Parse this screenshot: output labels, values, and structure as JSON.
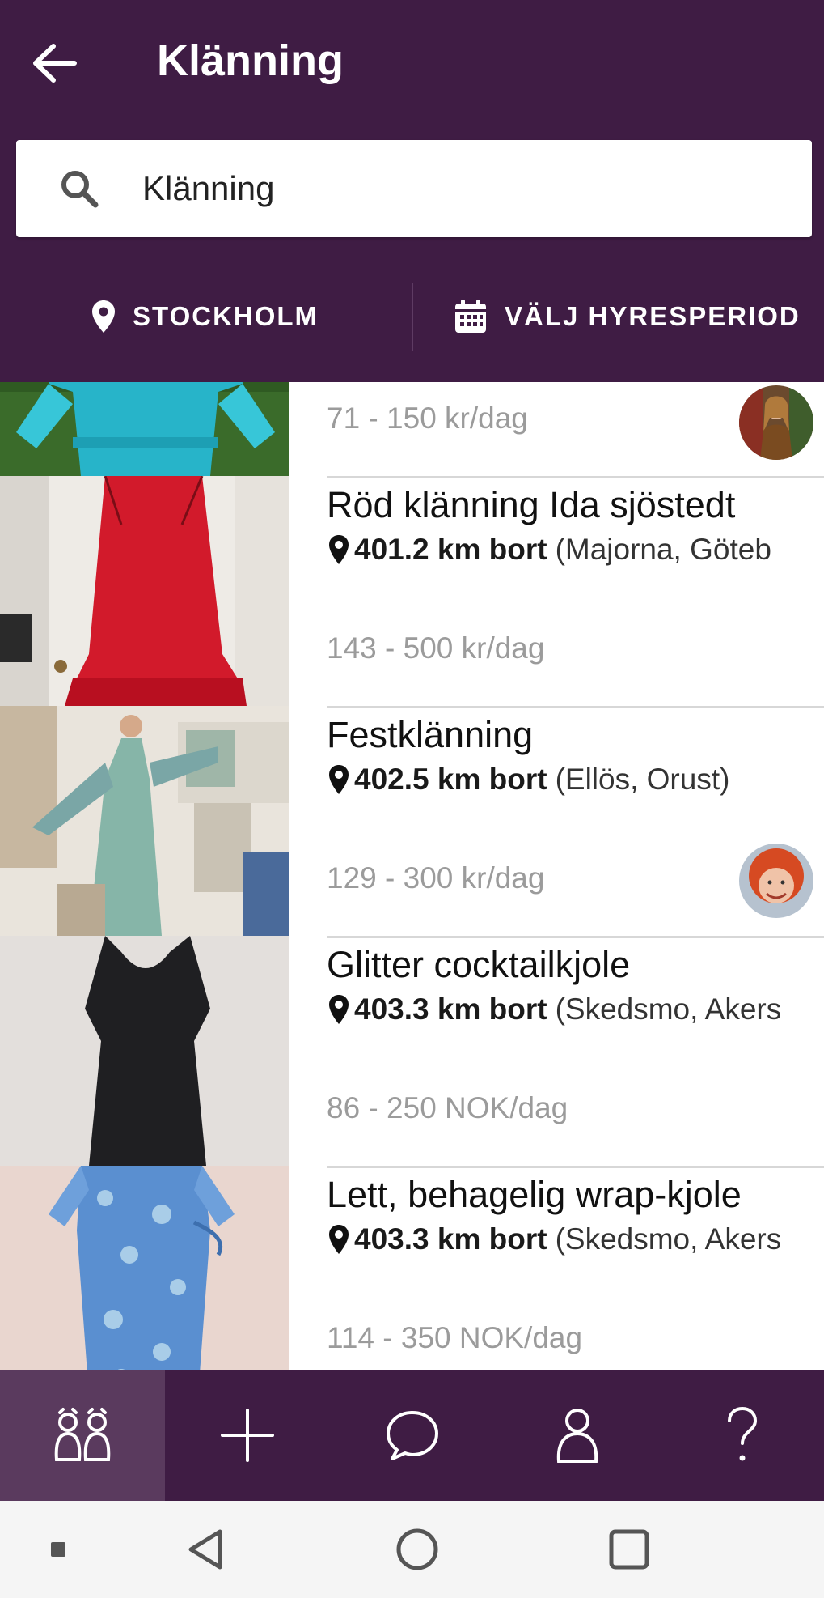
{
  "header": {
    "title": "Klänning"
  },
  "search": {
    "value": "Klänning"
  },
  "filters": {
    "location_label": "STOCKHOLM",
    "period_label": "VÄLJ HYRESPERIOD"
  },
  "listings": [
    {
      "title": "",
      "distance": "",
      "place": "",
      "price": "71 - 150 kr/dag",
      "has_avatar": true
    },
    {
      "title": "Röd klänning Ida sjöstedt",
      "distance": "401.2 km bort",
      "place": "(Majorna, Göteb",
      "price": "143 - 500 kr/dag",
      "has_avatar": false
    },
    {
      "title": "Festklänning",
      "distance": "402.5 km bort",
      "place": "(Ellös, Orust)",
      "price": "129 - 300 kr/dag",
      "has_avatar": true
    },
    {
      "title": "Glitter cocktailkjole",
      "distance": "403.3 km bort",
      "place": "(Skedsmo, Akers",
      "price": "86 - 250 NOK/dag",
      "has_avatar": false
    },
    {
      "title": "Lett, behagelig wrap-kjole",
      "distance": "403.3 km bort",
      "place": "(Skedsmo, Akers",
      "price": "114 - 350 NOK/dag",
      "has_avatar": false
    }
  ],
  "bottom_nav": [
    {
      "icon": "community-icon",
      "active": true
    },
    {
      "icon": "plus-icon",
      "active": false
    },
    {
      "icon": "chat-bubble-icon",
      "active": false
    },
    {
      "icon": "person-icon",
      "active": false
    },
    {
      "icon": "help-icon",
      "active": false
    }
  ],
  "system_nav": [
    "square-dot-icon",
    "back-triangle-icon",
    "home-circle-icon",
    "recents-square-icon"
  ],
  "colors": {
    "primary": "#3f1c44",
    "nav_active": "#5a3a5e",
    "price_gray": "#9b9b9b"
  }
}
